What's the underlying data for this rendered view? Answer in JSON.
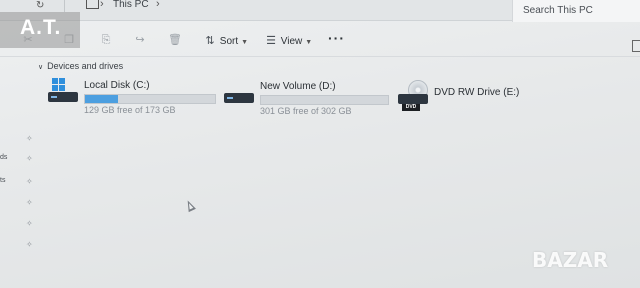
{
  "brand": "A.T.",
  "window": {
    "breadcrumb": "This PC",
    "search_placeholder": "Search This PC"
  },
  "toolbar": {
    "sort_label": "Sort",
    "view_label": "View",
    "more_label": "···"
  },
  "section": {
    "title": "Devices and drives"
  },
  "drives": [
    {
      "name": "Local Disk (C:)",
      "detail": "129 GB free of 173 GB",
      "used_fraction": 0.25
    },
    {
      "name": "New Volume (D:)",
      "detail": "301 GB free of 302 GB",
      "used_fraction": 0.0
    },
    {
      "name": "DVD RW Drive (E:)",
      "badge": "DVD"
    }
  ],
  "nav": {
    "partial_labels": [
      "ds",
      "ts"
    ]
  },
  "watermark": "BAZAR"
}
